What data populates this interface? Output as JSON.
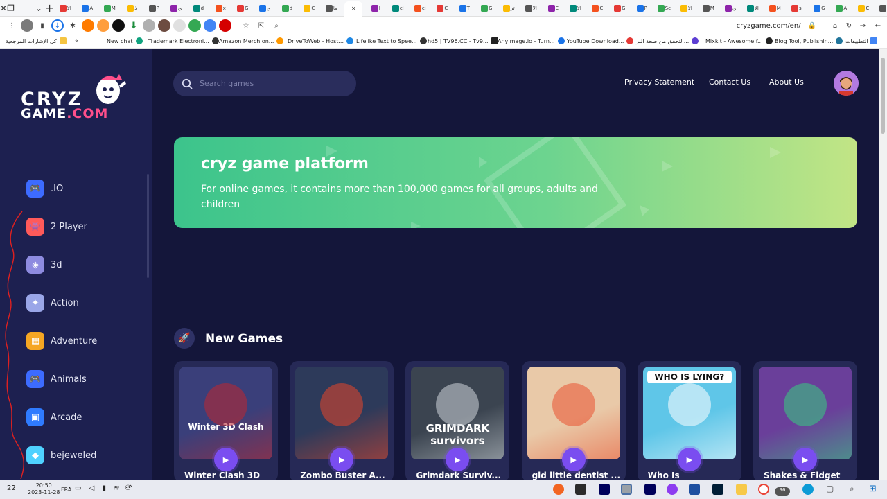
{
  "browser": {
    "window_controls": {
      "close": "✕",
      "restore": "❐",
      "menu": "⌄",
      "new_tab": "+"
    },
    "tab_labels": [
      "الا",
      "A",
      "M",
      "ذ",
      "P",
      "ي",
      "d",
      "x",
      "G",
      "ي",
      "d",
      "C",
      "ما",
      "ا",
      "cl",
      "ci",
      "C",
      "T",
      "G",
      "تر",
      "الا",
      "E",
      "الا",
      "C",
      "G",
      "P",
      "Sc",
      "الا",
      "M",
      "ي",
      "الا",
      "M",
      "si",
      "G",
      "A",
      "C",
      "Pr",
      "ما"
    ],
    "url": "cryzgame.com/en/",
    "bookmarks": [
      {
        "label": "كل الإشارات المرجعية",
        "color": "#f5c542"
      },
      {
        "label": "New chat",
        "color": "#10a37f"
      },
      {
        "label": "Trademark Electroni...",
        "color": "#555555"
      },
      {
        "label": "Amazon Merch on...",
        "color": "#ff9900"
      },
      {
        "label": "DriveToWeb - Host...",
        "color": "#1e88e5"
      },
      {
        "label": "Lifelike Text to Spee...",
        "color": "#333333"
      },
      {
        "label": "hd5 | TV96.CC - Tv9...",
        "color": "#222222"
      },
      {
        "label": "AnyImage.io - Turn...",
        "color": "#1a73e8"
      },
      {
        "label": "YouTube Download...",
        "color": "#e53935"
      },
      {
        "label": "التحقق من صحة البر...",
        "color": "#5d3fd3"
      },
      {
        "label": "Mixkit - Awesome f...",
        "color": "#222222"
      },
      {
        "label": "Blog Tool, Publishin...",
        "color": "#21759b"
      },
      {
        "label": "التطبيقات",
        "color": "#4285f4"
      }
    ]
  },
  "site": {
    "logo": {
      "line1": "CRYZ",
      "line2_a": "GAME",
      "line2_b": ".COM"
    },
    "search_placeholder": "Search games",
    "nav": {
      "privacy": "Privacy Statement",
      "contact": "Contact Us",
      "about": "About Us"
    },
    "categories": [
      {
        "label": ".IO",
        "icon": "gamepad-icon",
        "color": "#3d6bff"
      },
      {
        "label": "2 Player",
        "icon": "two-player-icon",
        "color": "#ff5a5a"
      },
      {
        "label": "3d",
        "icon": "cube-icon",
        "color": "#8e8be0"
      },
      {
        "label": "Action",
        "icon": "action-icon",
        "color": "#9aa6e8"
      },
      {
        "label": "Adventure",
        "icon": "map-icon",
        "color": "#f5a623"
      },
      {
        "label": "Animals",
        "icon": "gamepad-icon",
        "color": "#3d6bff"
      },
      {
        "label": "Arcade",
        "icon": "arcade-icon",
        "color": "#2f7bff"
      },
      {
        "label": "bejeweled",
        "icon": "diamond-icon",
        "color": "#4fd1ff"
      }
    ],
    "banner": {
      "title": "cryz game platform",
      "text": "For online games, it contains more than 100,000 games for all groups, adults and children"
    },
    "new_games_title": "New Games",
    "games": [
      {
        "title": "Winter Clash 3D",
        "bg": "#3a3f7a",
        "accent": "#c0272d",
        "thumb_label": "Winter 3D Clash"
      },
      {
        "title": "Zombo Buster A...",
        "bg": "#2d3a5a",
        "accent": "#e8452a",
        "thumb_label": ""
      },
      {
        "title": "Grimdark Surviv...",
        "bg": "#3b4450",
        "accent": "#cfd6da",
        "thumb_label": "GRIMDARK survivors"
      },
      {
        "title": "gid little dentist ...",
        "bg": "#e9c9a8",
        "accent": "#e9512f",
        "thumb_label": ""
      },
      {
        "title": "Who Is",
        "bg": "#5fc6e8",
        "accent": "#ffffff",
        "thumb_label": "WHO IS LYING?"
      },
      {
        "title": "Shakes & Fidget",
        "bg": "#6a3f9a",
        "accent": "#35d07f",
        "thumb_label": ""
      }
    ]
  },
  "taskbar": {
    "time": "20:50",
    "date": "2023-11-28",
    "lang": "FRA",
    "temp": "22",
    "badge": "96"
  }
}
